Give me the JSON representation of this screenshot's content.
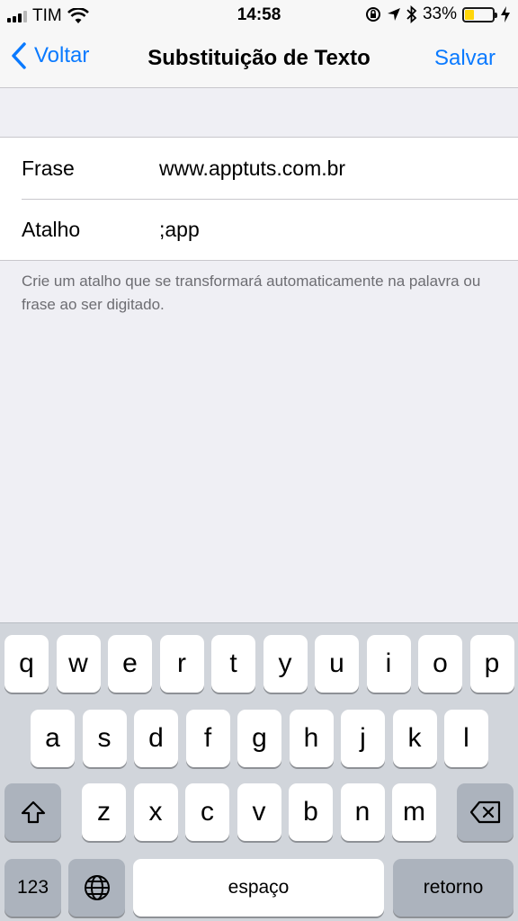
{
  "status_bar": {
    "carrier": "TIM",
    "time": "14:58",
    "battery_percent": "33%",
    "battery_level": 0.33,
    "icons": [
      "signal-icon",
      "wifi-icon",
      "orientation-lock-icon",
      "location-icon",
      "bluetooth-icon",
      "battery-icon",
      "charging-icon"
    ]
  },
  "nav": {
    "back_label": "Voltar",
    "title": "Substituição de Texto",
    "save_label": "Salvar"
  },
  "form": {
    "phrase_label": "Frase",
    "phrase_value": "www.apptuts.com.br",
    "shortcut_label": "Atalho",
    "shortcut_value": ";app",
    "footer": "Crie um atalho que se transformará automaticamente na palavra ou frase ao ser digitado."
  },
  "keyboard": {
    "row1": [
      "q",
      "w",
      "e",
      "r",
      "t",
      "y",
      "u",
      "i",
      "o",
      "p"
    ],
    "row2": [
      "a",
      "s",
      "d",
      "f",
      "g",
      "h",
      "j",
      "k",
      "l"
    ],
    "row3": [
      "z",
      "x",
      "c",
      "v",
      "b",
      "n",
      "m"
    ],
    "numbers_label": "123",
    "space_label": "espaço",
    "return_label": "retorno",
    "icons": [
      "shift-icon",
      "delete-icon",
      "globe-icon"
    ]
  },
  "colors": {
    "accent": "#0a7aff",
    "background": "#efeff4",
    "keyboard_bg": "#d1d5db",
    "battery_fill": "#ffd60a"
  }
}
